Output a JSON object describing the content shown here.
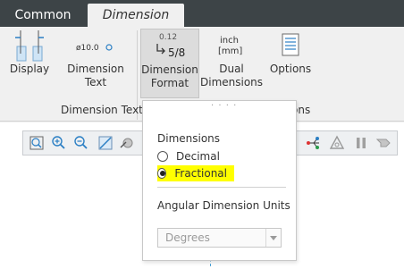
{
  "tabs": [
    {
      "label": "Common"
    },
    {
      "label": "Dimension"
    }
  ],
  "ribbon": {
    "display_label": "Display",
    "dimension_text_label": "Dimension\nText",
    "dimension_text_icon_text": "ø10.0",
    "dimension_format_label": "Dimension\nFormat",
    "dimension_format_icon_top": "0.12",
    "dimension_format_icon_frac": "5/8",
    "dual_dimensions_label": "Dual\nDimensions",
    "dual_icon_top": "inch",
    "dual_icon_bottom": "[mm]",
    "options_label": "Options",
    "group_dimension_text": "Dimension Text",
    "group_options_partial": "ons"
  },
  "popup": {
    "title": "Dimensions",
    "options": [
      "Decimal",
      "Fractional"
    ],
    "selected": "Fractional",
    "angular_title": "Angular Dimension Units",
    "angular_value": "Degrees"
  },
  "colors": {
    "tabbar": "#3d4447",
    "highlight": "#ffff00",
    "accent_blue": "#2b7fc4"
  }
}
